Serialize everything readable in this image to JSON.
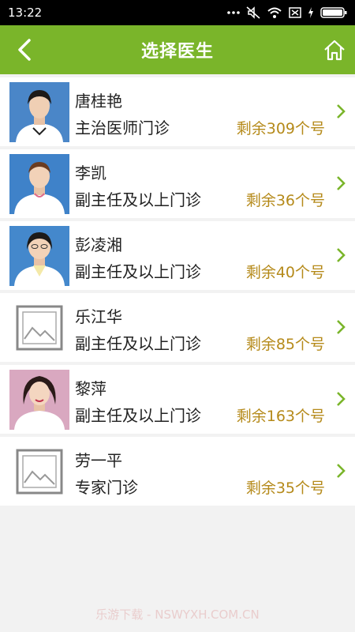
{
  "status": {
    "time": "13:22"
  },
  "header": {
    "title": "选择医生"
  },
  "doctors": [
    {
      "name": "唐桂艳",
      "clinic": "主治医师门诊",
      "remain": "剩余309个号",
      "photo": "photo"
    },
    {
      "name": "李凯",
      "clinic": "副主任及以上门诊",
      "remain": "剩余36个号",
      "photo": "photo"
    },
    {
      "name": "彭凌湘",
      "clinic": "副主任及以上门诊",
      "remain": "剩余40个号",
      "photo": "photo"
    },
    {
      "name": "乐江华",
      "clinic": "副主任及以上门诊",
      "remain": "剩余85个号",
      "photo": "placeholder"
    },
    {
      "name": "黎萍",
      "clinic": "副主任及以上门诊",
      "remain": "剩余163个号",
      "photo": "photo"
    },
    {
      "name": "劳一平",
      "clinic": "专家门诊",
      "remain": "剩余35个号",
      "photo": "placeholder"
    }
  ],
  "watermark": "乐游下载 - NSWYXH.COM.CN",
  "colors": {
    "header": "#7ab52a",
    "remain": "#b58a1a",
    "chevron": "#7ab52a"
  }
}
